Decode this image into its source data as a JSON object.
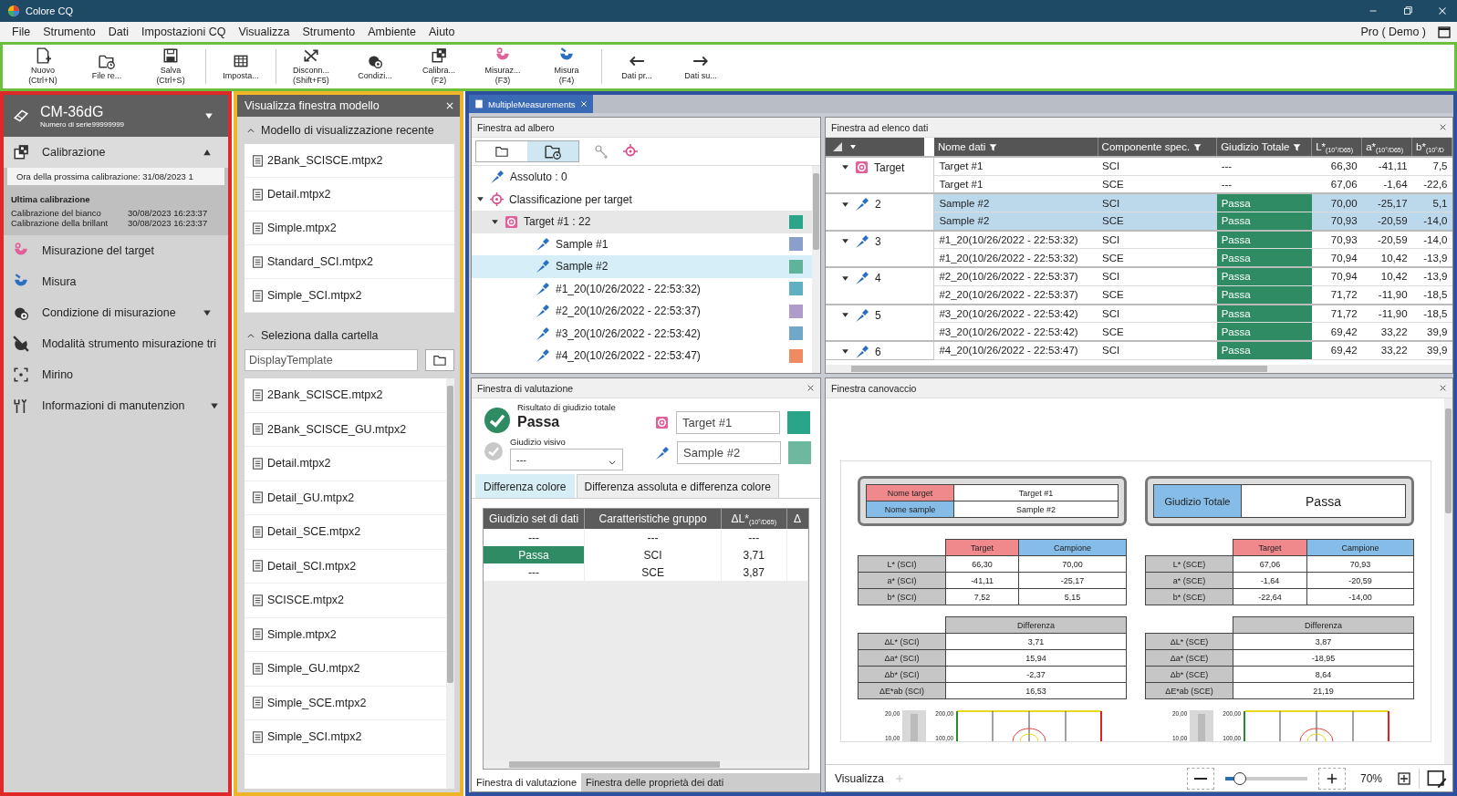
{
  "window": {
    "title": "Colore CQ"
  },
  "menu": [
    "File",
    "Strumento",
    "Dati",
    "Impostazioni CQ",
    "Visualizza",
    "Strumento",
    "Ambiente",
    "Aiuto"
  ],
  "edition": "Pro ( Demo )",
  "toolbar": [
    {
      "label": "Nuovo",
      "shortcut": "(Ctrl+N)",
      "group_start": false
    },
    {
      "label": "File re...",
      "group_start": false
    },
    {
      "label": "Salva",
      "shortcut": "(Ctrl+S)",
      "group_start": false
    },
    {
      "label": "Imposta...",
      "group_start": true
    },
    {
      "label": "Disconn...",
      "shortcut": "(Shift+F5)",
      "group_start": true
    },
    {
      "label": "Condizi...",
      "group_start": false
    },
    {
      "label": "Calibra...",
      "shortcut": "(F2)",
      "group_start": false
    },
    {
      "label": "Misuraz...",
      "shortcut": "(F3)",
      "group_start": false
    },
    {
      "label": "Misura",
      "shortcut": "(F4)",
      "group_start": false
    },
    {
      "label": "Dati pr...",
      "group_start": true
    },
    {
      "label": "Dati su...",
      "group_start": false
    }
  ],
  "instrument": {
    "model": "CM-36dG",
    "serial": "Numero di serie99999999",
    "expanded": false
  },
  "calibration": {
    "label": "Calibrazione",
    "expanded": true,
    "next": "Ora della prossima calibrazione: 31/08/2023 1",
    "last_title": "Ultima calibrazione",
    "last": [
      {
        "label": "Calibrazione del bianco",
        "time": "30/08/2023 16:23:37"
      },
      {
        "label": "Calibrazione della brillant",
        "time": "30/08/2023 16:23:37"
      }
    ]
  },
  "nav": [
    {
      "label": "Misurazione del target",
      "has_menu": false
    },
    {
      "label": "Misura",
      "has_menu": false
    },
    {
      "label": "Condizione di misurazione",
      "has_menu": true
    },
    {
      "label": "Modalità strumento misurazione tri",
      "has_menu": false
    },
    {
      "label": "Mirino",
      "has_menu": false
    },
    {
      "label": "Informazioni di manutenzion",
      "has_menu": true
    }
  ],
  "templates": {
    "title": "Visualizza finestra modello",
    "recent_title": "Modello di visualizzazione recente",
    "recent_expanded": true,
    "recent": [
      "2Bank_SCISCE.mtpx2",
      "Detail.mtpx2",
      "Simple.mtpx2",
      "Standard_SCI.mtpx2",
      "Simple_SCI.mtpx2"
    ],
    "folder_title": "Seleziona dalla cartella",
    "folder_expanded": true,
    "folder": "DisplayTemplate",
    "files": [
      "2Bank_SCISCE.mtpx2",
      "2Bank_SCISCE_GU.mtpx2",
      "Detail.mtpx2",
      "Detail_GU.mtpx2",
      "Detail_SCE.mtpx2",
      "Detail_SCI.mtpx2",
      "SCISCE.mtpx2",
      "Simple.mtpx2",
      "Simple_GU.mtpx2",
      "Simple_SCE.mtpx2",
      "Simple_SCI.mtpx2"
    ]
  },
  "document_tab": {
    "label": "MultipleMeasurements",
    "selected": true
  },
  "tree": {
    "title": "Finestra ad albero",
    "view_buttons": [
      {
        "selected": false
      },
      {
        "selected": true
      }
    ],
    "items": [
      {
        "kind": "sample",
        "label": "Assoluto : 0",
        "selected": false
      },
      {
        "kind": "classification",
        "label": "Classificazione per target",
        "expanded": true,
        "selected": false,
        "children": [
          {
            "kind": "target",
            "label": "Target #1 : 22",
            "expanded": true,
            "selected": false,
            "color": "#2aa58a",
            "children": [
              {
                "kind": "sample",
                "label": "Sample #1",
                "selected": false,
                "color": "#8a9fcc"
              },
              {
                "kind": "sample",
                "label": "Sample #2",
                "selected": true,
                "color": "#5fb39b"
              },
              {
                "kind": "sample",
                "label": "#1_20(10/26/2022 - 22:53:32)",
                "selected": false,
                "color": "#5fb0c0"
              },
              {
                "kind": "sample",
                "label": "#2_20(10/26/2022 - 22:53:37)",
                "selected": false,
                "color": "#b09ccc"
              },
              {
                "kind": "sample",
                "label": "#3_20(10/26/2022 - 22:53:42)",
                "selected": false,
                "color": "#6fa8c8"
              },
              {
                "kind": "sample",
                "label": "#4_20(10/26/2022 - 22:53:47)",
                "selected": false,
                "color": "#f08a60"
              }
            ]
          }
        ]
      }
    ]
  },
  "data_list": {
    "title": "Finestra ad elenco dati",
    "columns": [
      {
        "label": "Nome dati",
        "filter": true
      },
      {
        "label": "Componente spec.",
        "filter": true
      },
      {
        "label": "Giudizio Totale",
        "filter": true
      },
      {
        "label": "L*$_{(10°/D65)}$",
        "filter": false
      },
      {
        "label": "a*$_{(10°/D65)}$",
        "filter": false
      },
      {
        "label": "b*$_{(10°/D}$",
        "filter": false
      }
    ],
    "groups": [
      {
        "kind": "target",
        "label": "Target",
        "expanded": true,
        "selected": false,
        "rows": [
          {
            "cells": [
              "Target #1",
              "SCI",
              "---",
              "66,30",
              "-41,11",
              "7,5"
            ],
            "passed": false
          },
          {
            "cells": [
              "Target #1",
              "SCE",
              "---",
              "67,06",
              "-1,64",
              "-22,6"
            ],
            "passed": false
          }
        ]
      },
      {
        "kind": "sample",
        "label": "2",
        "expanded": true,
        "selected": true,
        "rows": [
          {
            "cells": [
              "Sample #2",
              "SCI",
              "Passa",
              "70,00",
              "-25,17",
              "5,1"
            ],
            "passed": true
          },
          {
            "cells": [
              "Sample #2",
              "SCE",
              "Passa",
              "70,93",
              "-20,59",
              "-14,0"
            ],
            "passed": true
          }
        ]
      },
      {
        "kind": "sample",
        "label": "3",
        "expanded": true,
        "selected": false,
        "rows": [
          {
            "cells": [
              "#1_20(10/26/2022 - 22:53:32)",
              "SCI",
              "Passa",
              "70,93",
              "-20,59",
              "-14,0"
            ],
            "passed": true
          },
          {
            "cells": [
              "#1_20(10/26/2022 - 22:53:32)",
              "SCE",
              "Passa",
              "70,94",
              "10,42",
              "-13,9"
            ],
            "passed": true
          }
        ]
      },
      {
        "kind": "sample",
        "label": "4",
        "expanded": true,
        "selected": false,
        "rows": [
          {
            "cells": [
              "#2_20(10/26/2022 - 22:53:37)",
              "SCI",
              "Passa",
              "70,94",
              "10,42",
              "-13,9"
            ],
            "passed": true
          },
          {
            "cells": [
              "#2_20(10/26/2022 - 22:53:37)",
              "SCE",
              "Passa",
              "71,72",
              "-11,90",
              "-18,5"
            ],
            "passed": true
          }
        ]
      },
      {
        "kind": "sample",
        "label": "5",
        "expanded": true,
        "selected": false,
        "rows": [
          {
            "cells": [
              "#3_20(10/26/2022 - 22:53:42)",
              "SCI",
              "Passa",
              "71,72",
              "-11,90",
              "-18,5"
            ],
            "passed": true
          },
          {
            "cells": [
              "#3_20(10/26/2022 - 22:53:42)",
              "SCE",
              "Passa",
              "69,42",
              "33,22",
              "39,9"
            ],
            "passed": true
          }
        ]
      },
      {
        "kind": "sample",
        "label": "6",
        "expanded": true,
        "selected": false,
        "rows": [
          {
            "cells": [
              "#4_20(10/26/2022 - 22:53:47)",
              "SCI",
              "Passa",
              "69,42",
              "33,22",
              "39,9"
            ],
            "passed": true
          }
        ]
      }
    ]
  },
  "evaluation": {
    "title": "Finestra di valutazione",
    "result_label": "Risultato di giudizio totale",
    "result": "Passa",
    "passed": true,
    "visual_label": "Giudizio visivo",
    "visual_value": "---",
    "visual_passed": false,
    "target": {
      "value": "Target #1",
      "color": "#2aa58a"
    },
    "sample": {
      "value": "Sample #2",
      "color": "#6fb8a0"
    },
    "tabs": [
      {
        "label": "Differenza colore",
        "selected": true
      },
      {
        "label": "Differenza assoluta e differenza colore",
        "selected": false
      }
    ],
    "columns": [
      "Giudizio set di dati",
      "Caratteristiche gruppo",
      "ΔL*$_{(10°/D65)}$",
      "Δ"
    ],
    "rows": [
      {
        "cells": [
          "---",
          "---",
          "---"
        ],
        "passed": false
      },
      {
        "cells": [
          "Passa",
          "SCI",
          "3,71"
        ],
        "passed": true
      },
      {
        "cells": [
          "---",
          "SCE",
          "3,87"
        ],
        "passed": false
      }
    ],
    "bottom_tabs": [
      {
        "label": "Finestra di valutazione",
        "selected": true
      },
      {
        "label": "Finestra delle proprietà dei dati",
        "selected": false
      }
    ]
  },
  "canvas": {
    "title": "Finestra canovaccio",
    "names": [
      {
        "kind": "target",
        "label": "Nome target",
        "value": "Target #1"
      },
      {
        "kind": "sample",
        "label": "Nome sample",
        "value": "Sample #2"
      }
    ],
    "verdict": {
      "label": "Giudizio Totale",
      "value": "Passa"
    },
    "sides": [
      {
        "columns": [
          null,
          {
            "kind": "target",
            "label": "Target"
          },
          {
            "kind": "sample",
            "label": "Campione"
          }
        ],
        "rows": [
          [
            "L* (SCI)",
            "66,30",
            "70,00"
          ],
          [
            "a* (SCI)",
            "-41,11",
            "-25,17"
          ],
          [
            "b* (SCI)",
            "7,52",
            "5,15"
          ]
        ],
        "diff_header": "Differenza",
        "diff_rows": [
          [
            "ΔL* (SCI)",
            "3,71"
          ],
          [
            "Δa* (SCI)",
            "15,94"
          ],
          [
            "Δb* (SCI)",
            "-2,37"
          ],
          [
            "ΔE*ab (SCI)",
            "16,53"
          ]
        ],
        "small_ticks": [
          "20,00",
          "10,00"
        ],
        "large_ticks": [
          "200,00",
          "100,00"
        ]
      },
      {
        "columns": [
          null,
          {
            "kind": "target",
            "label": "Target"
          },
          {
            "kind": "sample",
            "label": "Campione"
          }
        ],
        "rows": [
          [
            "L* (SCE)",
            "67,06",
            "70,93"
          ],
          [
            "a* (SCE)",
            "-1,64",
            "-20,59"
          ],
          [
            "b* (SCE)",
            "-22,64",
            "-14,00"
          ]
        ],
        "diff_header": "Differenza",
        "diff_rows": [
          [
            "ΔL* (SCE)",
            "3,87"
          ],
          [
            "Δa* (SCE)",
            "-18,95"
          ],
          [
            "Δb* (SCE)",
            "8,64"
          ],
          [
            "ΔE*ab (SCE)",
            "21,19"
          ]
        ],
        "small_ticks": [
          "20,00",
          "10,00"
        ],
        "large_ticks": [
          "200,00",
          "100,00"
        ]
      }
    ],
    "footer": {
      "tab": "Visualizza",
      "level": 0.2,
      "zoom": "70%"
    }
  }
}
